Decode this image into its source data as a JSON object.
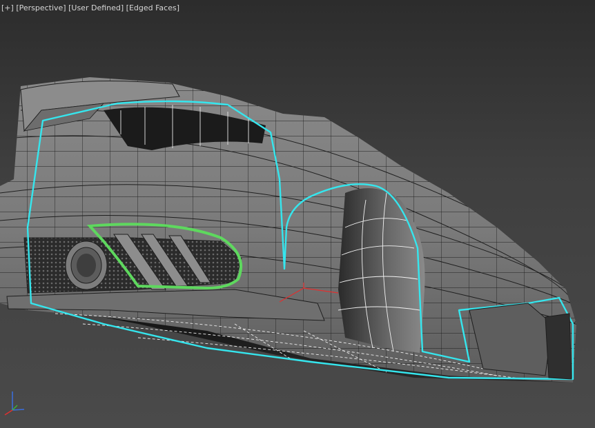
{
  "viewport": {
    "menu_label": "[+]",
    "view_label": "[Perspective]",
    "style_label": "[User Defined]",
    "shading_label": "[Edged Faces]"
  },
  "colors": {
    "background_top": "#2c2c2c",
    "background_bottom": "#4a4a4a",
    "mesh_surface": "#7a7a7a",
    "wireframe": "#1e1e1e",
    "selection_cyan": "#35e6ee",
    "selection_green": "#5ed85e",
    "edge_white": "#ffffff",
    "pivot_red": "#e03030"
  },
  "icons": {
    "viewport_axis": "xyz-axis-tripod-icon",
    "object_pivot": "transform-pivot-icon"
  }
}
